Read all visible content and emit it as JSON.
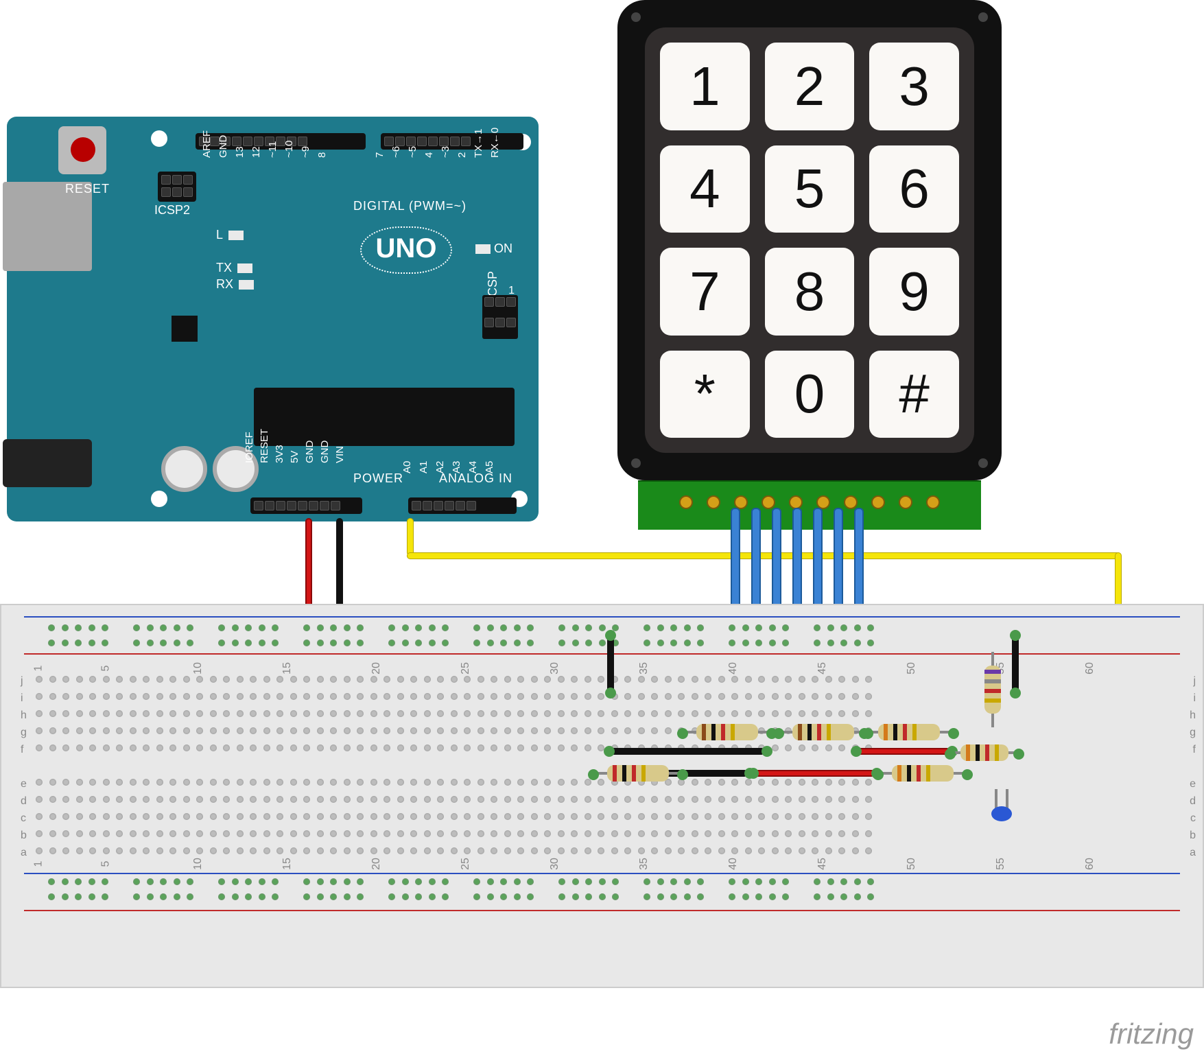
{
  "arduino": {
    "board_tag": "UNO",
    "reset_label": "RESET",
    "icsp2_label": "ICSP2",
    "icsp_label": "ICSP",
    "digital_label": "DIGITAL (PWM=~)",
    "power_label": "POWER",
    "analog_label": "ANALOG IN",
    "led_L": "L",
    "led_TX": "TX",
    "led_RX": "RX",
    "led_ON": "ON",
    "icsp_one": "1",
    "digital_pins_left": [
      "AREF",
      "GND",
      "13",
      "12",
      "~11",
      "~10",
      "~9",
      "8"
    ],
    "digital_pins_right": [
      "7",
      "~6",
      "~5",
      "4",
      "~3",
      "2",
      "TX→1",
      "RX←0"
    ],
    "power_pins": [
      "IOREF",
      "RESET",
      "3V3",
      "5V",
      "GND",
      "GND",
      "VIN"
    ],
    "analog_pins": [
      "A0",
      "A1",
      "A2",
      "A3",
      "A4",
      "A5"
    ]
  },
  "keypad": {
    "keys": [
      "1",
      "2",
      "3",
      "4",
      "5",
      "6",
      "7",
      "8",
      "9",
      "*",
      "0",
      "#"
    ]
  },
  "breadboard": {
    "row_labels_top": [
      "j",
      "i",
      "h",
      "g",
      "f"
    ],
    "row_labels_bottom": [
      "e",
      "d",
      "c",
      "b",
      "a"
    ],
    "column_numbers": [
      "1",
      "5",
      "10",
      "15",
      "20",
      "25",
      "30",
      "35",
      "40",
      "45",
      "50",
      "55",
      "60"
    ]
  },
  "watermark": "fritzing"
}
